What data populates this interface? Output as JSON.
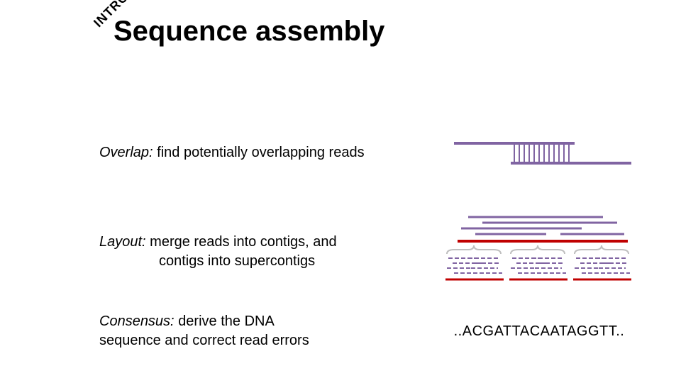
{
  "corner_tag": "INTRO",
  "title": "Sequence assembly",
  "steps": {
    "overlap": {
      "term": "Overlap:",
      "desc1": "find potentially overlapping reads"
    },
    "layout": {
      "term": "Layout:",
      "desc1": "merge reads into contigs, and",
      "desc2": "contigs into supercontigs"
    },
    "consensus": {
      "term": "Consensus:",
      "desc1": "derive the DNA",
      "desc2": "sequence and correct read errors",
      "sequence": "..ACGATTACAATAGGTT.."
    }
  },
  "colors": {
    "read": "#8064a2",
    "consensus_line": "#c00000",
    "brace": "#bfbfbf"
  }
}
